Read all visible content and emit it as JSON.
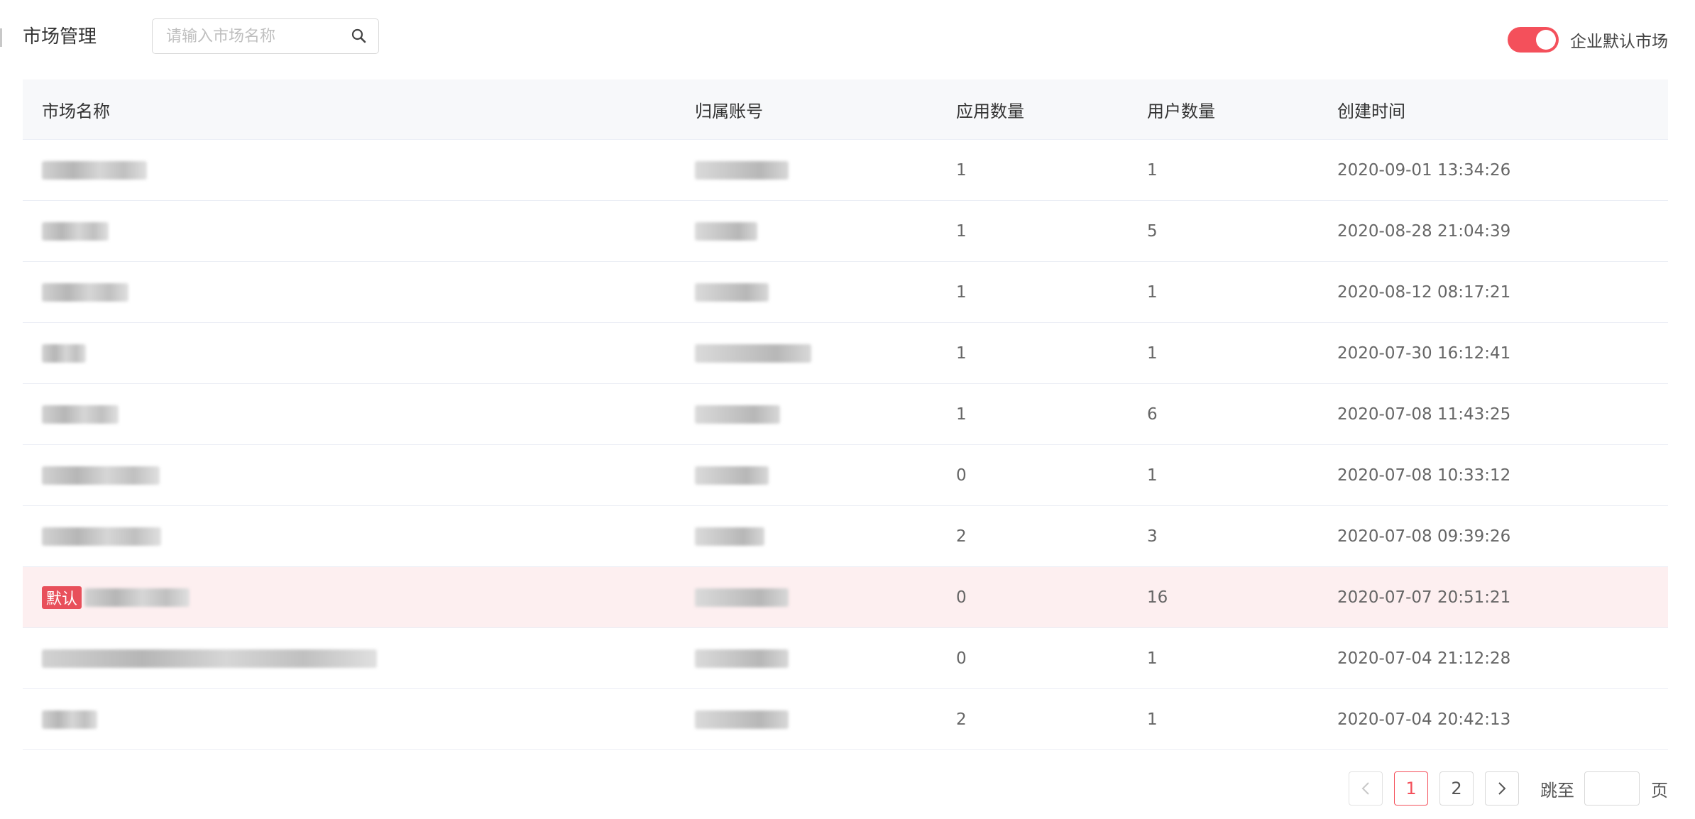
{
  "header": {
    "title": "市场管理",
    "search_placeholder": "请输入市场名称",
    "toggle_label": "企业默认市场",
    "toggle_on": true
  },
  "colors": {
    "accent": "#f4505b",
    "highlight_row": "#fdeff0",
    "header_bg": "#f7f8fa"
  },
  "table": {
    "headers": [
      "市场名称",
      "归属账号",
      "应用数量",
      "用户数量",
      "创建时间"
    ],
    "rows": [
      {
        "apps": "1",
        "users": "1",
        "created": "2020-09-01 13:34:26",
        "is_default": false
      },
      {
        "apps": "1",
        "users": "5",
        "created": "2020-08-28 21:04:39",
        "is_default": false
      },
      {
        "apps": "1",
        "users": "1",
        "created": "2020-08-12 08:17:21",
        "is_default": false
      },
      {
        "apps": "1",
        "users": "1",
        "created": "2020-07-30 16:12:41",
        "is_default": false
      },
      {
        "apps": "1",
        "users": "6",
        "created": "2020-07-08 11:43:25",
        "is_default": false
      },
      {
        "apps": "0",
        "users": "1",
        "created": "2020-07-08 10:33:12",
        "is_default": false
      },
      {
        "apps": "2",
        "users": "3",
        "created": "2020-07-08 09:39:26",
        "is_default": false
      },
      {
        "apps": "0",
        "users": "16",
        "created": "2020-07-07 20:51:21",
        "is_default": true,
        "tag": "默认"
      },
      {
        "apps": "0",
        "users": "1",
        "created": "2020-07-04 21:12:28",
        "is_default": false
      },
      {
        "apps": "2",
        "users": "1",
        "created": "2020-07-04 20:42:13",
        "is_default": false
      }
    ]
  },
  "pagination": {
    "prev_icon": "chevron-left-icon",
    "next_icon": "chevron-right-icon",
    "pages": [
      "1",
      "2"
    ],
    "current": "1",
    "jump_label": "跳至",
    "page_unit": "页"
  }
}
